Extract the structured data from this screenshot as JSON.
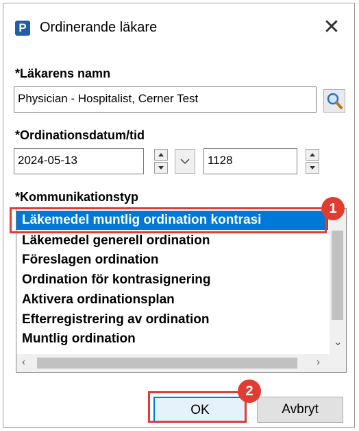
{
  "window": {
    "title": "Ordinerande läkare",
    "app_icon_letter": "P",
    "close_glyph": "✕"
  },
  "physician": {
    "label": "*Läkarens namn",
    "value": "Physician - Hospitalist, Cerner Test"
  },
  "datetime": {
    "label": "*Ordinationsdatum/tid",
    "date_value": "2024-05-13",
    "time_value": "1128"
  },
  "communication": {
    "label": "*Kommunikationstyp",
    "items": [
      "Läkemedel muntlig ordination kontrasi",
      "Läkemedel generell ordination",
      "Föreslagen ordination",
      "Ordination för kontrasignering",
      "Aktivera ordinationsplan",
      "Efterregistrering av ordination",
      "Muntlig ordination"
    ],
    "selected_index": 0
  },
  "buttons": {
    "ok": "OK",
    "cancel": "Avbryt"
  },
  "annotations": {
    "step1": "1",
    "step2": "2",
    "color": "#e03c31"
  },
  "icons": {
    "search": "search-icon",
    "calendar_dropdown": "chevron-down-icon"
  }
}
